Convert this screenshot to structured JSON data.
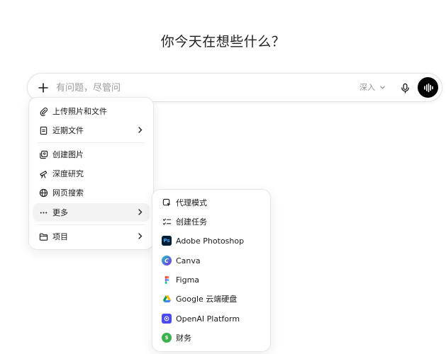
{
  "headline": "你今天在想些什么？",
  "composer": {
    "placeholder": "有问题，尽管问",
    "mode_label": "深入"
  },
  "main_menu": {
    "items": [
      {
        "label": "上传照片和文件",
        "icon": "paperclip-icon"
      },
      {
        "label": "近期文件",
        "icon": "file-icon"
      },
      {
        "label": "创建图片",
        "icon": "image-icon"
      },
      {
        "label": "深度研究",
        "icon": "telescope-icon"
      },
      {
        "label": "网页搜索",
        "icon": "globe-icon"
      },
      {
        "label": "更多",
        "icon": "ellipsis-icon"
      },
      {
        "label": "项目",
        "icon": "folder-icon"
      }
    ]
  },
  "more_menu": {
    "items": [
      {
        "label": "代理模式",
        "icon": "agent-icon"
      },
      {
        "label": "创建任务",
        "icon": "task-list-icon"
      },
      {
        "label": "Adobe Photoshop",
        "icon": "photoshop-icon",
        "color": "#001e36",
        "badge": "Ps"
      },
      {
        "label": "Canva",
        "icon": "canva-icon",
        "color": "#20c4cb",
        "badge": "C"
      },
      {
        "label": "Figma",
        "icon": "figma-icon"
      },
      {
        "label": "Google 云端硬盘",
        "icon": "google-drive-icon"
      },
      {
        "label": "OpenAI Platform",
        "icon": "openai-platform-icon",
        "color": "#4b4bf0"
      },
      {
        "label": "财务",
        "icon": "finance-icon",
        "color": "#3cb34a",
        "badge": "$"
      }
    ]
  }
}
